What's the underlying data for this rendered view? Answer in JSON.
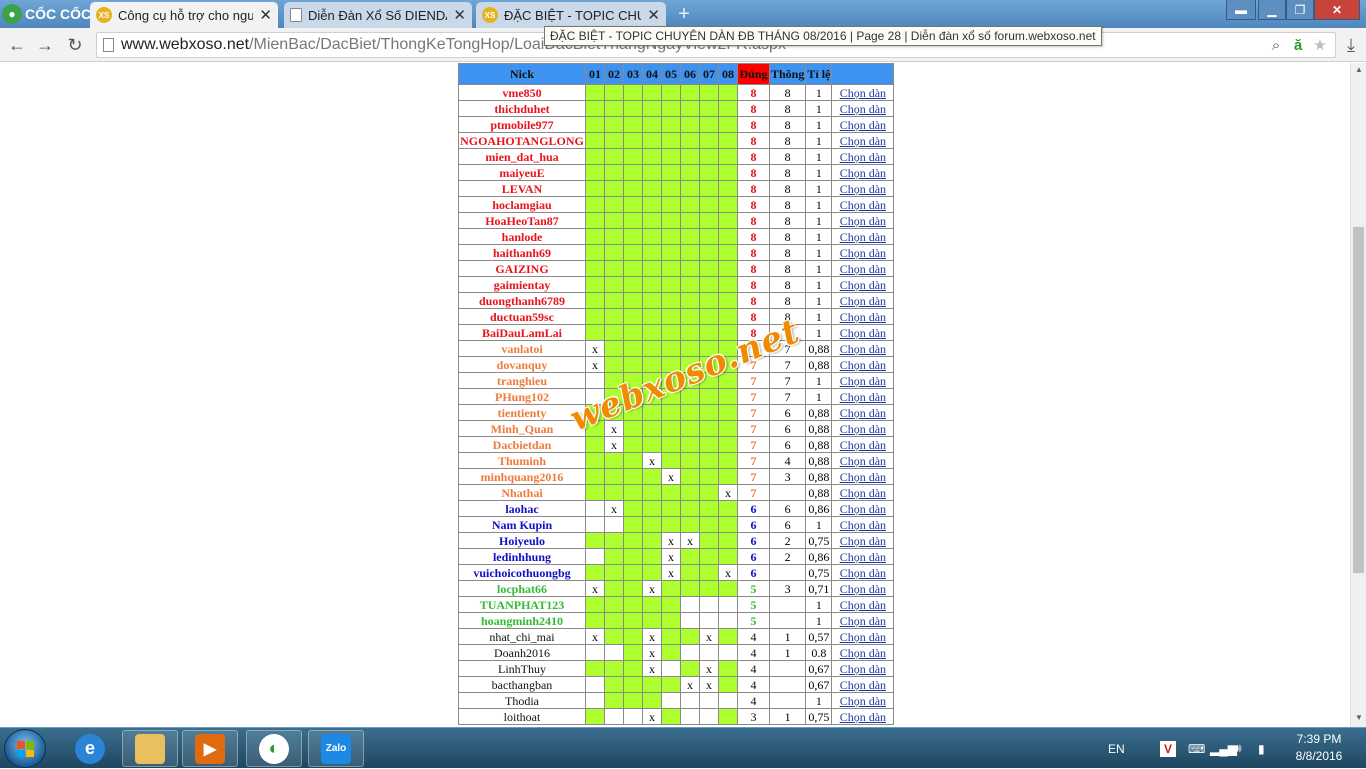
{
  "browser": {
    "brand": "CỐC CỐC",
    "tabs": [
      {
        "label": "Công cụ hỗ trợ cho người",
        "icon": "xoso-icon"
      },
      {
        "label": "Diễn Đàn Xổ Số DIENDAN",
        "icon": "document-icon"
      },
      {
        "label": "ĐẶC BIỆT - TOPIC CHUYÊN",
        "icon": "xoso-icon"
      }
    ],
    "url_host": "www.webxoso.net",
    "url_path": "/MienBac/DacBiet/ThongKeTongHop/LoaiDacBietThangNgayView2FR.aspx",
    "tooltip": "ĐẶC BIỆT - TOPIC CHUYÊN DÀN ĐB THÁNG 08/2016 | Page 28 | Diễn đàn xổ số forum.webxoso.net"
  },
  "table": {
    "headers": {
      "nick": "Nick",
      "days": [
        "01",
        "02",
        "03",
        "04",
        "05",
        "06",
        "07",
        "08"
      ],
      "dung": "Đúng",
      "thong": "Thông",
      "tile": "Tỉ lệ"
    },
    "rows": [
      {
        "nick": "vme850",
        "cells": "GGGGGGGG",
        "dung": "8",
        "thong": "8",
        "tile": "1",
        "chon": "Chọn dàn"
      },
      {
        "nick": "thichduhet",
        "cells": "GGGGGGGG",
        "dung": "8",
        "thong": "8",
        "tile": "1",
        "chon": "Chọn dàn"
      },
      {
        "nick": "ptmobile977",
        "cells": "GGGGGGGG",
        "dung": "8",
        "thong": "8",
        "tile": "1",
        "chon": "Chọn dàn"
      },
      {
        "nick": "NGOAHOTANGLONG",
        "cells": "GGGGGGGG",
        "dung": "8",
        "thong": "8",
        "tile": "1",
        "chon": "Chọn dàn"
      },
      {
        "nick": "mien_dat_hua",
        "cells": "GGGGGGGG",
        "dung": "8",
        "thong": "8",
        "tile": "1",
        "chon": "Chọn dàn"
      },
      {
        "nick": "maiyeuE",
        "cells": "GGGGGGGG",
        "dung": "8",
        "thong": "8",
        "tile": "1",
        "chon": "Chọn dàn"
      },
      {
        "nick": "LEVAN",
        "cells": "GGGGGGGG",
        "dung": "8",
        "thong": "8",
        "tile": "1",
        "chon": "Chọn dàn"
      },
      {
        "nick": "hoclamgiau",
        "cells": "GGGGGGGG",
        "dung": "8",
        "thong": "8",
        "tile": "1",
        "chon": "Chọn dàn"
      },
      {
        "nick": "HoaHeoTan87",
        "cells": "GGGGGGGG",
        "dung": "8",
        "thong": "8",
        "tile": "1",
        "chon": "Chọn dàn"
      },
      {
        "nick": "hanlode",
        "cells": "GGGGGGGG",
        "dung": "8",
        "thong": "8",
        "tile": "1",
        "chon": "Chọn dàn"
      },
      {
        "nick": "haithanh69",
        "cells": "GGGGGGGG",
        "dung": "8",
        "thong": "8",
        "tile": "1",
        "chon": "Chọn dàn"
      },
      {
        "nick": "GAIZING",
        "cells": "GGGGGGGG",
        "dung": "8",
        "thong": "8",
        "tile": "1",
        "chon": "Chọn dàn"
      },
      {
        "nick": "gaimientay",
        "cells": "GGGGGGGG",
        "dung": "8",
        "thong": "8",
        "tile": "1",
        "chon": "Chọn dàn"
      },
      {
        "nick": "duongthanh6789",
        "cells": "GGGGGGGG",
        "dung": "8",
        "thong": "8",
        "tile": "1",
        "chon": "Chọn dàn"
      },
      {
        "nick": "ductuan59sc",
        "cells": "GGGGGGGG",
        "dung": "8",
        "thong": "8",
        "tile": "1",
        "chon": "Chọn dàn"
      },
      {
        "nick": "BaiDauLamLai",
        "cells": "GGGGGGGG",
        "dung": "8",
        "thong": "8",
        "tile": "1",
        "chon": "Chọn dàn"
      },
      {
        "nick": "vanlatoi",
        "cells": "XGGGGGGG",
        "dung": "7",
        "thong": "7",
        "tile": "0,88",
        "chon": "Chọn dàn"
      },
      {
        "nick": "dovanquy",
        "cells": "XGGGGGGG",
        "dung": "7",
        "thong": "7",
        "tile": "0,88",
        "chon": "Chọn dàn"
      },
      {
        "nick": "tranghieu",
        "cells": "WGGGGGGG",
        "dung": "7",
        "thong": "7",
        "tile": "1",
        "chon": "Chọn dàn"
      },
      {
        "nick": "PHung102",
        "cells": "WGGGGGGG",
        "dung": "7",
        "thong": "7",
        "tile": "1",
        "chon": "Chọn dàn"
      },
      {
        "nick": "tientienty",
        "cells": "GGGGGGGG",
        "dung": "7",
        "thong": "6",
        "tile": "0,88",
        "chon": "Chọn dàn"
      },
      {
        "nick": "Minh_Quan",
        "cells": "GXGGGGGG",
        "dung": "7",
        "thong": "6",
        "tile": "0,88",
        "chon": "Chọn dàn"
      },
      {
        "nick": "Dacbietdan",
        "cells": "GXGGGGGG",
        "dung": "7",
        "thong": "6",
        "tile": "0,88",
        "chon": "Chọn dàn"
      },
      {
        "nick": "Thuminh",
        "cells": "GGGXGGGG",
        "dung": "7",
        "thong": "4",
        "tile": "0,88",
        "chon": "Chọn dàn"
      },
      {
        "nick": "minhquang2016",
        "cells": "GGGGXGGG",
        "dung": "7",
        "thong": "3",
        "tile": "0,88",
        "chon": "Chọn dàn"
      },
      {
        "nick": "Nhathai",
        "cells": "GGGGGGGX",
        "dung": "7",
        "thong": "",
        "tile": "0,88",
        "chon": "Chọn dàn"
      },
      {
        "nick": "laohac",
        "cells": "WXGGGGGG",
        "dung": "6",
        "thong": "6",
        "tile": "0,86",
        "chon": "Chọn dàn"
      },
      {
        "nick": "Nam Kupin",
        "cells": "WWGGGGGG",
        "dung": "6",
        "thong": "6",
        "tile": "1",
        "chon": "Chọn dàn"
      },
      {
        "nick": "Hoiyeulo",
        "cells": "GGGGXXGG",
        "dung": "6",
        "thong": "2",
        "tile": "0,75",
        "chon": "Chọn dàn"
      },
      {
        "nick": "ledinhhung",
        "cells": "WGGGXGGG",
        "dung": "6",
        "thong": "2",
        "tile": "0,86",
        "chon": "Chọn dàn"
      },
      {
        "nick": "vuichoicothuongbg",
        "cells": "GGGGXGGX",
        "dung": "6",
        "thong": "",
        "tile": "0,75",
        "chon": "Chọn dàn"
      },
      {
        "nick": "locphat66",
        "cells": "XGGXGGGG",
        "dung": "5",
        "thong": "3",
        "tile": "0,71",
        "chon": "Chọn dàn"
      },
      {
        "nick": "TUANPHAT123",
        "cells": "GGGGGWWW",
        "dung": "5",
        "thong": "",
        "tile": "1",
        "chon": "Chọn dàn"
      },
      {
        "nick": "hoangminh2410",
        "cells": "GGGGGWWW",
        "dung": "5",
        "thong": "",
        "tile": "1",
        "chon": "Chọn dàn"
      },
      {
        "nick": "nhat_chi_mai",
        "cells": "XGGXGGXG",
        "dung": "4",
        "thong": "1",
        "tile": "0,57",
        "chon": "Chọn dàn"
      },
      {
        "nick": "Doanh2016",
        "cells": "WWGXGWWW",
        "dung": "4",
        "thong": "1",
        "tile": "0.8",
        "chon": "Chọn dàn"
      },
      {
        "nick": "LinhThuy",
        "cells": "GGGXWGXG",
        "dung": "4",
        "thong": "",
        "tile": "0,67",
        "chon": "Chọn dàn"
      },
      {
        "nick": "bacthangban",
        "cells": "WGGGGXXG",
        "dung": "4",
        "thong": "",
        "tile": "0,67",
        "chon": "Chọn dàn"
      },
      {
        "nick": "Thodia",
        "cells": "WGGGWWWW",
        "dung": "4",
        "thong": "",
        "tile": "1",
        "chon": "Chọn dàn"
      },
      {
        "nick": "loithoat",
        "cells": "GWWXGWWG",
        "dung": "3",
        "thong": "1",
        "tile": "0,75",
        "chon": "Chọn dàn"
      }
    ]
  },
  "watermark": "webxoso.net",
  "taskbar": {
    "apps": [
      "file-explorer",
      "internet-explorer",
      "media-player",
      "coccoc-browser",
      "zalo"
    ],
    "zalo_label": "Zalo",
    "language": "EN",
    "time": "7:39 PM",
    "date": "8/8/2016"
  },
  "colors": {
    "header_blue": "#3f93f0",
    "dung_red": "#ff0000",
    "green_cell": "#adff2f"
  }
}
